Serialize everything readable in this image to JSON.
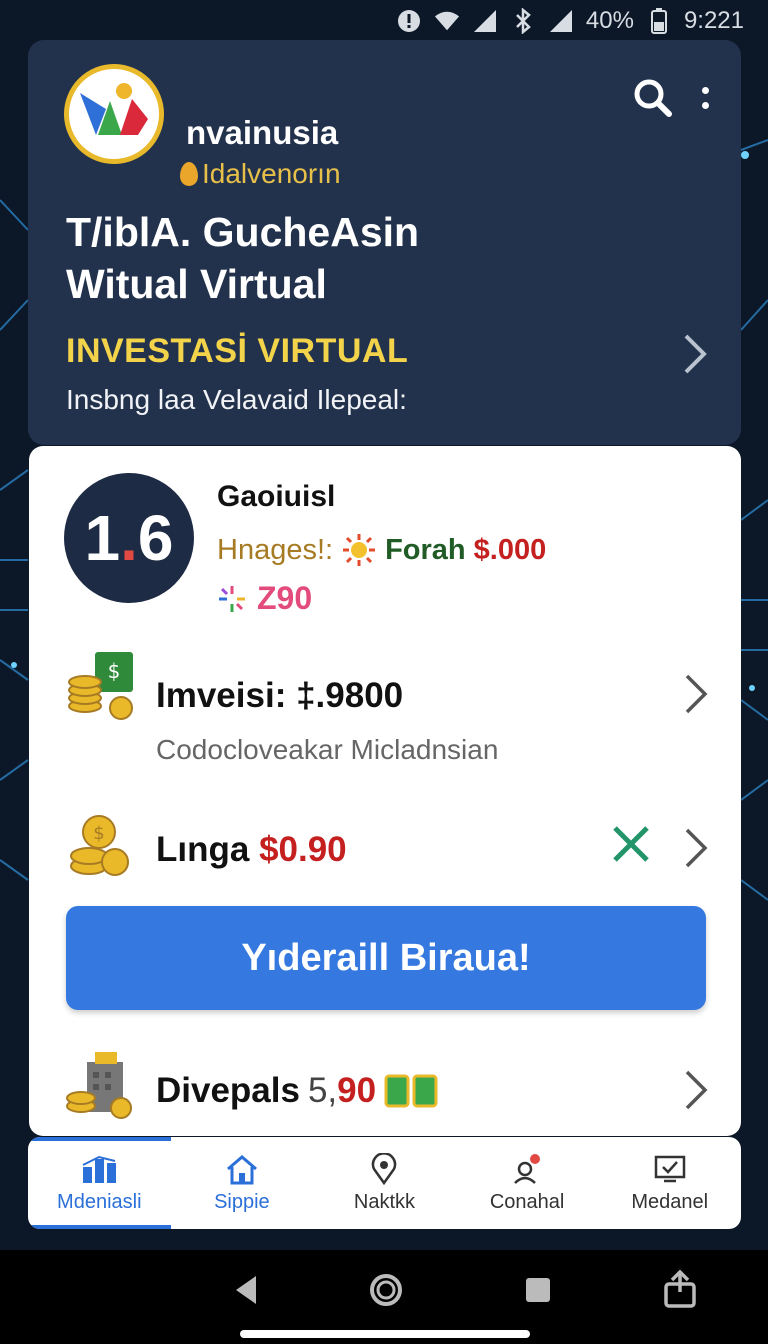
{
  "status_bar": {
    "battery": "40%",
    "time": "9:221"
  },
  "header": {
    "app_name": "nvainusia",
    "app_subtitle": "Idalvenorın",
    "hero_title_line1": "T/iblA. GucheAsin",
    "hero_title_line2": "Witual Virtual",
    "invest_label": "INVESTASİ VIRTUAL",
    "description": "Insbng laa Velavaid Ilepeal:"
  },
  "profile": {
    "badge_left": "1",
    "badge_dot": ".",
    "badge_right": "6",
    "name": "Gaoiuisl",
    "label": "Hnages!:",
    "from_label": "Forah",
    "amount": "$.000",
    "score": "Z90"
  },
  "rows": {
    "invest": {
      "title": "Imveisi: ‡.9800",
      "subtitle": "Codocloveakar Micladnsian"
    },
    "linga": {
      "label": "Lınga",
      "price": "$0.90"
    },
    "divepals": {
      "label": "Divepals",
      "price_gray": "5,",
      "price_red": "90"
    }
  },
  "cta": {
    "label": "Yıderaill Biraua!"
  },
  "bottom_nav": [
    {
      "label": "Mdeniasli",
      "icon": "bar-chart-icon"
    },
    {
      "label": "Sippie",
      "icon": "home-icon"
    },
    {
      "label": "Naktkk",
      "icon": "location-pin-icon"
    },
    {
      "label": "Conahal",
      "icon": "notification-person-icon"
    },
    {
      "label": "Medanel",
      "icon": "tv-check-icon"
    }
  ],
  "colors": {
    "accent": "#3478e0",
    "header_bg": "#23324c",
    "gold": "#f3d34a",
    "price_red": "#c52020"
  }
}
